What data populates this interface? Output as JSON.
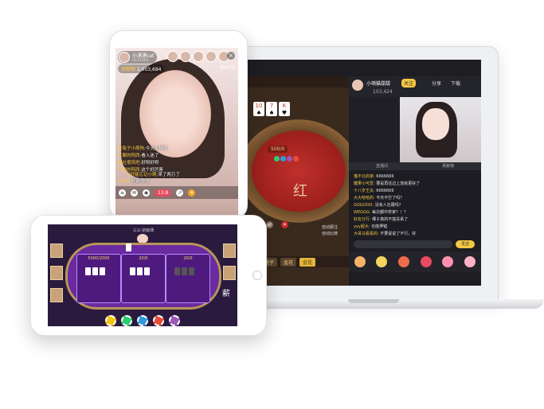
{
  "laptop": {
    "game": {
      "cards": [
        {
          "rank": "10",
          "suit": "♠"
        },
        {
          "rank": "7",
          "suit": "♠"
        },
        {
          "rank": "K",
          "suit": "♥"
        }
      ],
      "score": "500/0",
      "table_text": "红",
      "bet_buttons": [
        "对子",
        "金花",
        "金花"
      ],
      "toggle_labels": [
        "自动跟注",
        "自动比牌"
      ]
    },
    "stream": {
      "streamer_name": "小萌猫甜甜",
      "viewer_count": "103,424",
      "follow_label": "关注",
      "share_label": "分享",
      "download_label": "下载",
      "chat_tabs": [
        "直播间",
        "贡献榜"
      ],
      "chat": [
        {
          "name": "猫不北的家:",
          "msg": "6666666"
        },
        {
          "name": "糖果小可爱:",
          "msg": "要是再往边上放就更好了"
        },
        {
          "name": "十八岁王夫:",
          "msg": "6666666"
        },
        {
          "name": "大大哈哈的:",
          "msg": "今天不打了吗？"
        },
        {
          "name": "GOGOOO:",
          "msg": "没有人在跟吗？"
        },
        {
          "name": "WEGGG:",
          "msg": "每次都中奖家？！？"
        },
        {
          "name": "好友分行:",
          "msg": "哪子真的不能关系了"
        },
        {
          "name": "yyy超大:",
          "msg": "也能押错"
        },
        {
          "name": "大哥马看看的:",
          "msg": "不要说说了不行，好"
        }
      ],
      "send_label": "发送"
    }
  },
  "phone": {
    "host_name": "小漂漂cat",
    "host_id": "ID:21904",
    "coin_label": "贡献榜",
    "coin_value": "1,003,684",
    "room_id": "89374",
    "chat": [
      {
        "name": "金兔子小萌狗:",
        "msg": "今天太棒啦"
      },
      {
        "name": "无聊的阿西:",
        "msg": "看入迷了"
      },
      {
        "name": "暮吐很风吧:",
        "msg": "好呀好呀"
      },
      {
        "name": "无聊的阿西:",
        "msg": "这个好厉害"
      },
      {
        "name": "只好能忘记小萌:",
        "msg": "来了两万了"
      },
      {
        "name": "UU88:",
        "msg": "好奇怪哦"
      }
    ],
    "bet_value": "13.8"
  },
  "tablet": {
    "room_title": "三公·初级场",
    "zones": [
      {
        "label": "5000/2000"
      },
      {
        "label": "20/0"
      },
      {
        "label": "20/0"
      }
    ],
    "side_text": "薪",
    "chip_values": [
      "5",
      "10",
      "50",
      "100",
      "500"
    ],
    "colors": {
      "table": "#6a2aa0",
      "table_rim": "#b8965a",
      "zone_label": "#ffd36b"
    }
  }
}
